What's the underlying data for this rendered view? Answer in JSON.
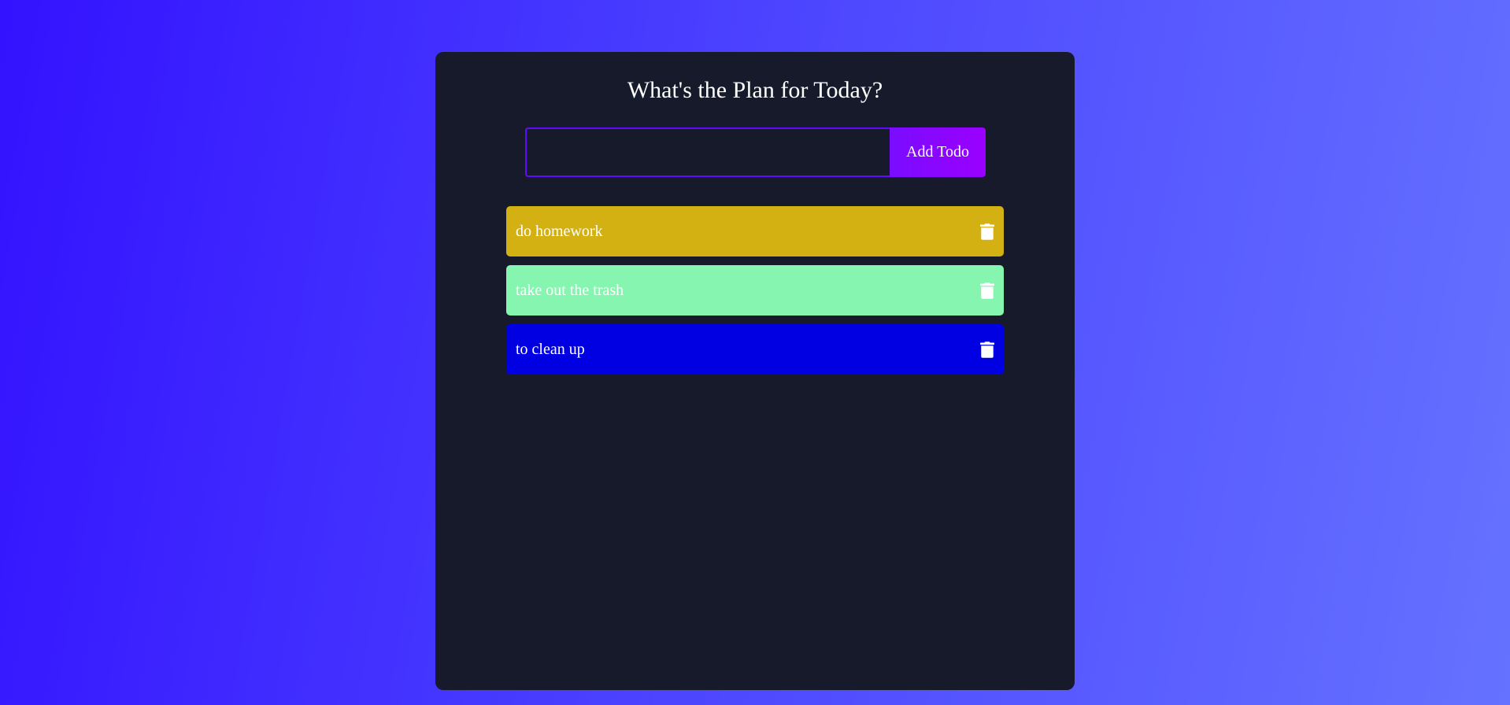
{
  "app": {
    "title": "What's the Plan for Today?"
  },
  "form": {
    "input_value": "",
    "input_placeholder": "",
    "button_label": "Add Todo"
  },
  "todos": [
    {
      "text": "do homework",
      "color": "#d4b113",
      "icon": "delete-icon"
    },
    {
      "text": "take out the trash",
      "color": "#85f5b0",
      "icon": "delete-icon"
    },
    {
      "text": "to clean up",
      "color": "#0000e3",
      "icon": "delete-icon"
    }
  ],
  "colors": {
    "background_start": "#3312ff",
    "background_end": "#6572ff",
    "panel": "#161a2b",
    "input_border": "#5d0cff",
    "button_start": "#7a0cff",
    "button_end": "#9a00ff"
  }
}
